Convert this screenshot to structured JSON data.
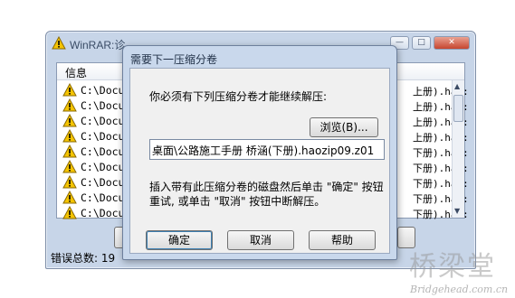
{
  "background_window": {
    "title": "WinRAR:诊",
    "column_header": "信息",
    "rows_left": [
      "C:\\Docum",
      "C:\\Docum",
      "C:\\Docum",
      "C:\\Docum",
      "C:\\Docum",
      "C:\\Docum",
      "C:\\Docum",
      "C:\\Docum",
      "C:\\Docum"
    ],
    "rows_right": [
      "上册).hao:",
      "上册).hao:",
      "上册).hao:",
      "上册).hao:",
      "下册).hao:",
      "下册).hao:",
      "下册).hao:",
      "下册).hao:",
      "下册).hao:"
    ],
    "error_total_label": "错误总数: 19",
    "controls": {
      "minimize": "—",
      "maximize": "□"
    }
  },
  "dialog": {
    "title": "需要下一压缩分卷",
    "prompt": "你必须有下列压缩分卷才能继续解压:",
    "browse_label": "浏览(B)...",
    "path_value": "桌面\\公路施工手册 桥涵(下册).haozip09.z01",
    "instruction": "插入带有此压缩分卷的磁盘然后单击 \"确定\" 按钮重试, 或单击 \"取消\" 按钮中断解压。",
    "buttons": {
      "ok": "确定",
      "cancel": "取消",
      "help": "帮助"
    }
  },
  "watermark": {
    "logo_text": "桥梁堂",
    "url": "Bridgehead.com.cn"
  },
  "colors": {
    "warning_yellow": "#f5c400",
    "title_bg": "#c9d8ec"
  }
}
